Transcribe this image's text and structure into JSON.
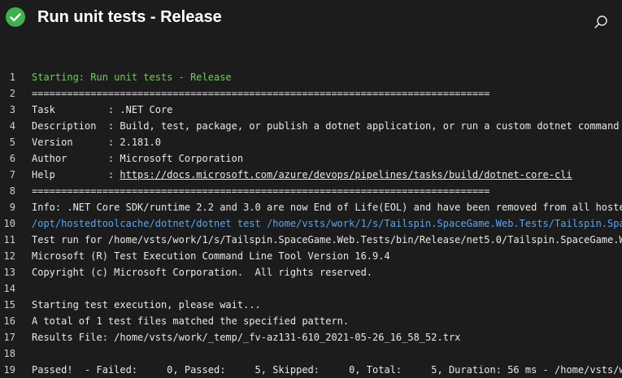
{
  "header": {
    "status_icon": "check-circle-icon",
    "status_color": "#3fb24f",
    "title": "Run unit tests - Release",
    "search_icon": "search-icon"
  },
  "colors": {
    "background": "#1c1c1c",
    "text": "#e8e8e8",
    "success_text": "#6fcf5c",
    "command_text": "#5ba4f2"
  },
  "log": {
    "lines": [
      {
        "num": "1",
        "segments": [
          {
            "text": "Starting: Run unit tests - Release",
            "style": "green"
          }
        ]
      },
      {
        "num": "2",
        "segments": [
          {
            "text": "==============================================================================",
            "style": "plain"
          }
        ]
      },
      {
        "num": "3",
        "segments": [
          {
            "text": "Task         : .NET Core",
            "style": "plain"
          }
        ]
      },
      {
        "num": "4",
        "segments": [
          {
            "text": "Description  : Build, test, package, or publish a dotnet application, or run a custom dotnet command",
            "style": "plain"
          }
        ]
      },
      {
        "num": "5",
        "segments": [
          {
            "text": "Version      : 2.181.0",
            "style": "plain"
          }
        ]
      },
      {
        "num": "6",
        "segments": [
          {
            "text": "Author       : Microsoft Corporation",
            "style": "plain"
          }
        ]
      },
      {
        "num": "7",
        "segments": [
          {
            "text": "Help         : ",
            "style": "plain"
          },
          {
            "text": "https://docs.microsoft.com/azure/devops/pipelines/tasks/build/dotnet-core-cli",
            "style": "link"
          }
        ]
      },
      {
        "num": "8",
        "segments": [
          {
            "text": "==============================================================================",
            "style": "plain"
          }
        ]
      },
      {
        "num": "9",
        "segments": [
          {
            "text": "Info: .NET Core SDK/runtime 2.2 and 3.0 are now End of Life(EOL) and have been removed from all hoste",
            "style": "plain"
          }
        ]
      },
      {
        "num": "10",
        "segments": [
          {
            "text": "/opt/hostedtoolcache/dotnet/dotnet test /home/vsts/work/1/s/Tailspin.SpaceGame.Web.Tests/Tailspin.Spa",
            "style": "blue"
          }
        ]
      },
      {
        "num": "11",
        "segments": [
          {
            "text": "Test run for /home/vsts/work/1/s/Tailspin.SpaceGame.Web.Tests/bin/Release/net5.0/Tailspin.SpaceGame.W",
            "style": "plain"
          }
        ]
      },
      {
        "num": "12",
        "segments": [
          {
            "text": "Microsoft (R) Test Execution Command Line Tool Version 16.9.4",
            "style": "plain"
          }
        ]
      },
      {
        "num": "13",
        "segments": [
          {
            "text": "Copyright (c) Microsoft Corporation.  All rights reserved.",
            "style": "plain"
          }
        ]
      },
      {
        "num": "14",
        "segments": [
          {
            "text": "",
            "style": "plain"
          }
        ]
      },
      {
        "num": "15",
        "segments": [
          {
            "text": "Starting test execution, please wait...",
            "style": "plain"
          }
        ]
      },
      {
        "num": "16",
        "segments": [
          {
            "text": "A total of 1 test files matched the specified pattern.",
            "style": "plain"
          }
        ]
      },
      {
        "num": "17",
        "segments": [
          {
            "text": "Results File: /home/vsts/work/_temp/_fv-az131-610_2021-05-26_16_58_52.trx",
            "style": "plain"
          }
        ]
      },
      {
        "num": "18",
        "segments": [
          {
            "text": "",
            "style": "plain"
          }
        ]
      },
      {
        "num": "19",
        "segments": [
          {
            "text": "Passed!  - Failed:     0, Passed:     5, Skipped:     0, Total:     5, Duration: 56 ms - /home/vsts/w",
            "style": "plain"
          }
        ]
      }
    ]
  }
}
